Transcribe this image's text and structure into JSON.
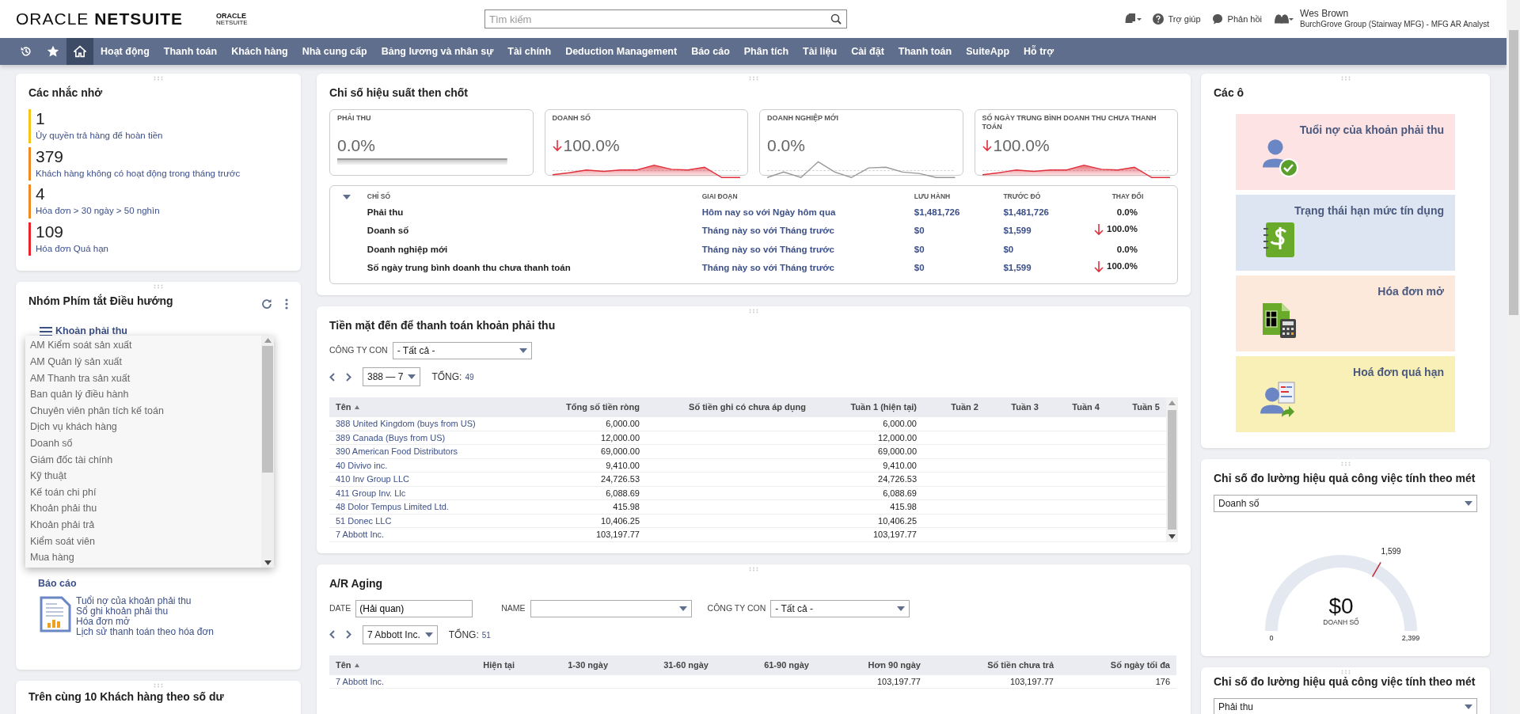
{
  "header": {
    "logo": {
      "left": "ORACLE",
      "right": "NETSUITE"
    },
    "sub_logo": {
      "top": "ORACLE",
      "bottom": "NETSUITE"
    },
    "search": {
      "placeholder": "Tìm kiếm"
    },
    "links": [
      {
        "kind": "help",
        "label": "Trợ giúp"
      },
      {
        "kind": "feedback",
        "label": "Phản hồi"
      }
    ],
    "user": {
      "name": "Wes Brown",
      "role": "BurchGrove Group (Stairway MFG) - MFG AR Analyst"
    }
  },
  "nav": [
    {
      "kind": "recent",
      "selected": false
    },
    {
      "kind": "favorites",
      "selected": false
    },
    {
      "kind": "home",
      "selected": true
    },
    {
      "kind": "text",
      "label": "Hoạt động",
      "selected": false
    },
    {
      "kind": "text",
      "label": "Thanh toán",
      "selected": false
    },
    {
      "kind": "text",
      "label": "Khách hàng",
      "selected": false
    },
    {
      "kind": "text",
      "label": "Nhà cung cấp",
      "selected": false
    },
    {
      "kind": "text",
      "label": "Bảng lương và nhân sự",
      "selected": false
    },
    {
      "kind": "text",
      "label": "Tài chính",
      "selected": false
    },
    {
      "kind": "text",
      "label": "Deduction Management",
      "selected": false
    },
    {
      "kind": "text",
      "label": "Báo cáo",
      "selected": false
    },
    {
      "kind": "text",
      "label": "Phân tích",
      "selected": false
    },
    {
      "kind": "text",
      "label": "Tài liệu",
      "selected": false
    },
    {
      "kind": "text",
      "label": "Cài đặt",
      "selected": false
    },
    {
      "kind": "text",
      "label": "Thanh toán",
      "selected": false
    },
    {
      "kind": "text",
      "label": "SuiteApp",
      "selected": false
    },
    {
      "kind": "text",
      "label": "Hỗ trợ",
      "selected": false
    }
  ],
  "reminders": {
    "title": "Các nhắc nhở",
    "items": [
      {
        "count": "1",
        "label": "Ủy quyền trả hàng để hoàn tiền",
        "color": "#f5c518"
      },
      {
        "count": "379",
        "label": "Khách hàng không có hoạt động trong tháng trước",
        "color": "#f08a24"
      },
      {
        "count": "4",
        "label": "Hóa đơn > 30 ngày > 50 nghìn",
        "color": "#f08a24"
      },
      {
        "count": "109",
        "label": "Hóa đơn Quá hạn",
        "color": "#e8252b"
      }
    ]
  },
  "shortcuts": {
    "title": "Nhóm Phím tắt Điều hướng",
    "group": "Khoản phải thu",
    "dropdown": {
      "items": [
        "AM Kiểm soát sản xuất",
        "AM Quản lý sản xuất",
        "AM Thanh tra sản xuất",
        "Ban quản lý điều hành",
        "Chuyên viên phân tích kế toán",
        "Dịch vụ khách hàng",
        "Doanh số",
        "Giám đốc tài chính",
        "Kỹ thuật",
        "Kế toán chi phí",
        "Khoản phải thu",
        "Khoản phải trả",
        "Kiểm soát viên",
        "Mua hàng"
      ]
    },
    "reports": {
      "heading": "Báo cáo",
      "links": [
        "Tuổi nợ của khoản phải thu",
        "Sổ ghi khoản phải thu",
        "Hóa đơn mở",
        "Lịch sử thanh toán theo hóa đơn"
      ]
    }
  },
  "top_customers": {
    "title": "Trên cùng 10 Khách hàng theo số dư"
  },
  "kpi": {
    "title": "Chỉ số hiệu suất then chốt",
    "cards": [
      {
        "title": "PHẢI THU",
        "value": "0.0%",
        "decreased": false,
        "kind": "flat"
      },
      {
        "title": "DOANH SỐ",
        "value": "100.0%",
        "decreased": true,
        "kind": "area"
      },
      {
        "title": "DOANH NGHIỆP MỚI",
        "value": "0.0%",
        "decreased": false,
        "kind": "line"
      },
      {
        "title": "SỐ NGÀY TRUNG BÌNH DOANH THU CHƯA THANH TOÁN",
        "value": "100.0%",
        "decreased": true,
        "kind": "area"
      }
    ],
    "table": {
      "expanded": true,
      "columns": [
        "CHỈ SỐ",
        "GIAI ĐOẠN",
        "LƯU HÀNH",
        "TRƯỚC ĐÓ",
        "THAY ĐỔI"
      ],
      "rows": [
        {
          "metric": "Phải thu",
          "period": "Hôm nay so với Ngày hôm qua",
          "current": "$1,481,726",
          "previous": "$1,481,726",
          "change": "0.0%",
          "decreased": false
        },
        {
          "metric": "Doanh số",
          "period": "Tháng này so với Tháng trước",
          "current": "$0",
          "previous": "$1,599",
          "change": "100.0%",
          "decreased": true
        },
        {
          "metric": "Doanh nghiệp mới",
          "period": "Tháng này so với Tháng trước",
          "current": "$0",
          "previous": "$0",
          "change": "0.0%",
          "decreased": false
        },
        {
          "metric": "Số ngày trung bình doanh thu chưa thanh toán",
          "period": "Tháng này so với Tháng trước",
          "current": "$0",
          "previous": "$1,599",
          "change": "100.0%",
          "decreased": true
        }
      ]
    }
  },
  "cash": {
    "title": "Tiền mặt đến để thanh toán khoản phải thu",
    "filter": {
      "label": "CÔNG TY CON",
      "value": "- Tất cả -"
    },
    "pager": {
      "range": "388 — 7",
      "total_label": "TỔNG:",
      "total": "49"
    },
    "table": {
      "columns": [
        {
          "label": "Tên",
          "sorted": true
        },
        {
          "label": "Tổng số tiền ròng",
          "sorted": false
        },
        {
          "label": "Số tiền ghi có chưa áp dụng",
          "sorted": false
        },
        {
          "label": "Tuần 1 (hiện tại)",
          "sorted": false
        },
        {
          "label": "Tuần 2",
          "sorted": false
        },
        {
          "label": "Tuần 3",
          "sorted": false
        },
        {
          "label": "Tuần 4",
          "sorted": false
        },
        {
          "label": "Tuần 5",
          "sorted": false
        }
      ],
      "rows": [
        {
          "name": "388 United Kingdom (buys from US)",
          "net_total": "6,000.00",
          "week_1": "6,000.00"
        },
        {
          "name": "389 Canada (Buys from US)",
          "net_total": "12,000.00",
          "week_1": "12,000.00"
        },
        {
          "name": "390 American Food Distributors",
          "net_total": "69,000.00",
          "week_1": "69,000.00"
        },
        {
          "name": "40 Divivo inc.",
          "net_total": "9,410.00",
          "week_1": "9,410.00"
        },
        {
          "name": "410 Inv Group LLC",
          "net_total": "24,726.53",
          "week_1": "24,726.53"
        },
        {
          "name": "411 Group Inv. Llc",
          "net_total": "6,088.69",
          "week_1": "6,088.69"
        },
        {
          "name": "48 Dolor Tempus Limited Ltd.",
          "net_total": "415.98",
          "week_1": "415.98"
        },
        {
          "name": "51 Donec LLC",
          "net_total": "10,406.25",
          "week_1": "10,406.25"
        },
        {
          "name": "7 Abbott Inc.",
          "net_total": "103,197.77",
          "week_1": "103,197.77"
        }
      ]
    }
  },
  "aging": {
    "title": "A/R Aging",
    "fields": [
      {
        "kind": "text",
        "label": "DATE",
        "value": "(Hải quan)"
      },
      {
        "kind": "select",
        "label": "NAME"
      },
      {
        "kind": "select",
        "label": "CÔNG TY CON",
        "value": "- Tất cả -"
      }
    ],
    "pager": {
      "range": "7 Abbott Inc.",
      "total_label": "TỔNG:",
      "total": "51"
    },
    "table": {
      "columns": [
        {
          "label": "Tên",
          "sorted": true
        },
        {
          "label": "Hiện tại",
          "sorted": false
        },
        {
          "label": "1-30 ngày",
          "sorted": false
        },
        {
          "label": "31-60 ngày",
          "sorted": false
        },
        {
          "label": "61-90 ngày",
          "sorted": false
        },
        {
          "label": "Hơn 90 ngày",
          "sorted": false
        },
        {
          "label": "Số tiền chưa trả",
          "sorted": false
        },
        {
          "label": "Số ngày tối đa",
          "sorted": false
        }
      ],
      "rows": [
        {
          "name": "7 Abbott Inc.",
          "over_90": "103,197.77",
          "outstanding": "103,197.77",
          "max_days": "176"
        }
      ]
    }
  },
  "tiles": {
    "title": "Các ô",
    "items": [
      {
        "label": "Tuổi nợ của khoản phải thu",
        "kind": "user_check",
        "color": "#fde3e3"
      },
      {
        "label": "Trạng thái hạn mức tín dụng",
        "kind": "ledger",
        "color": "#dce5f1"
      },
      {
        "label": "Hóa đơn mở",
        "kind": "sheet_calc",
        "color": "#fce9dc"
      },
      {
        "label": "Hoá đơn quá hạn",
        "kind": "user_doc",
        "color": "#f9f0b7"
      }
    ]
  },
  "meter": {
    "title": "Chỉ số đo lường hiệu quả công việc tính theo mét",
    "select": "Doanh số",
    "gauge": {
      "value": "$0",
      "label": "DOANH SỐ",
      "min": "0",
      "max": "2,399",
      "target": {
        "label": "1,599",
        "level": 0.667
      }
    }
  },
  "meter_2": {
    "title": "Chỉ số đo lường hiệu quả công việc tính theo mét",
    "select": "Phải thu"
  }
}
